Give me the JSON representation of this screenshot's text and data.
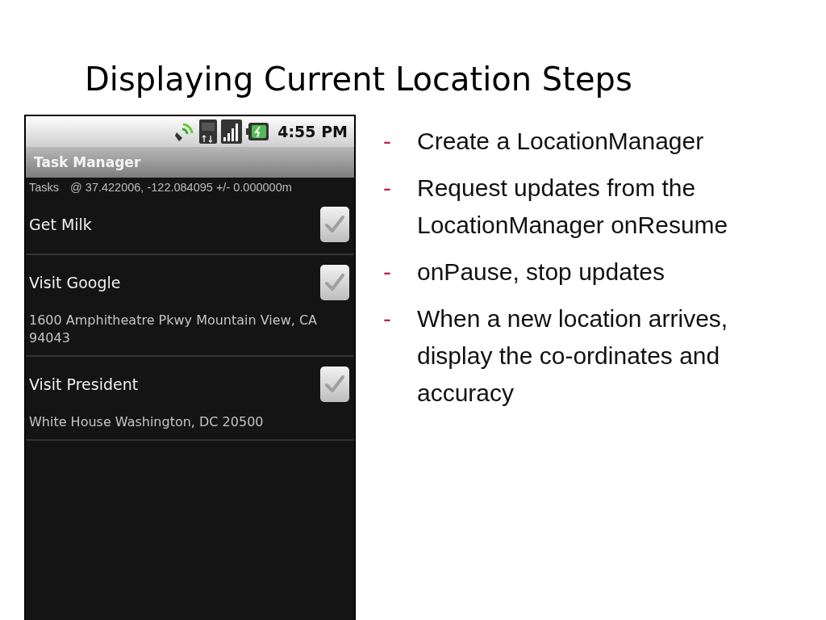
{
  "slide_title": "Displaying Current Location Steps",
  "phone": {
    "status_bar": {
      "time": "4:55 PM"
    },
    "title_bar": "Task Manager",
    "header": {
      "label": "Tasks",
      "location": "@ 37.422006, -122.084095 +/- 0.000000m"
    },
    "tasks": [
      {
        "title": "Get Milk",
        "checked": false
      },
      {
        "title": "Visit Google",
        "note": "1600 Amphitheatre Pkwy Mountain View, CA 94043",
        "checked": false
      },
      {
        "title": "Visit President",
        "note": "White House Washington, DC 20500",
        "checked": false
      }
    ]
  },
  "bullets": [
    {
      "marker": "-",
      "text": "Create a LocationManager"
    },
    {
      "marker": "-",
      "text": "Request updates from the LocationManager onResume"
    },
    {
      "marker": "-",
      "text": "onPause, stop updates"
    },
    {
      "marker": "-",
      "text": "When a new location arrives, display the co-ordinates and accuracy"
    }
  ]
}
